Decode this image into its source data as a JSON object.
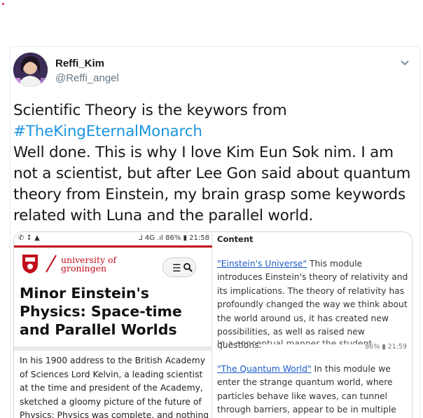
{
  "tweet": {
    "author_name": "Reffi_Kim",
    "author_handle": "@Reffi_angel",
    "text_line1": "Scientific Theory is the keywors from",
    "hashtag": "#TheKingEternalMonarch",
    "text_body": "Well done. This is why I love Kim Eun Sok nim. I am not a scientist, but after Lee Gon said about quantum theory from Einstein, my brain grasp some keywords related with Luna and the parallel world."
  },
  "media_left": {
    "status_left": "✆ ↕ ▲",
    "status_right": "⅃ 4G .ıl 86% ▮ 21:58",
    "logo_line1": "university of",
    "logo_line2": "groningen",
    "menu_icon": "☰",
    "heading": "Minor Einstein's Physics: Space-time and Parallel Worlds",
    "body": "In his 1900 address to the British Academy of Sciences Lord Kelvin, a leading scientist at the time and president of the Academy, sketched a gloomy picture of the future of Physics: Physics was complete, and nothing remained"
  },
  "media_right": {
    "label": "Content",
    "link1": "\"Einstein's Universe\"",
    "text1": " This module introduces Einstein's theory of relativity and its implications. The theory of relativity has profoundly changed the way we think about the world around us, it has created new possibilities, as well as raised new questions.",
    "cut_text": "In a conceptual manner the student",
    "ghost_status": "86% ▮ 21:59",
    "link2": "\"The Quantum World\"",
    "text2": " In this module we enter the strange quantum world, where particles behave like waves, can tunnel through barriers, appear to be in multiple"
  },
  "icons": {
    "chevron": "chevron-down-icon",
    "avatar": "profile-avatar"
  },
  "colors": {
    "hashtag": "#1b95e0",
    "brand_red": "#c00e1a",
    "link_blue": "#1a5dc9"
  }
}
